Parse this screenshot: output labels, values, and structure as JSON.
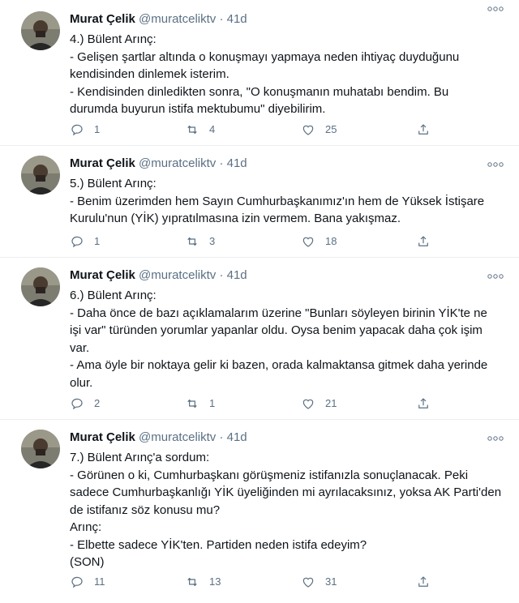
{
  "tweets": [
    {
      "name": "Murat Çelik",
      "handle": "@muratceliktv",
      "time": "41d",
      "lines": [
        "4.) Bülent Arınç:",
        "- Gelişen şartlar altında o konuşmayı yapmaya neden ihtiyaç duyduğunu",
        "kendisinden dinlemek isterim.",
        "- Kendisinden dinledikten sonra, \"O konuşmanın muhatabı bendim. Bu",
        "durumda buyurun istifa mektubumu\" diyebilirim."
      ],
      "replies": "1",
      "retweets": "4",
      "likes": "25"
    },
    {
      "name": "Murat Çelik",
      "handle": "@muratceliktv",
      "time": "41d",
      "lines": [
        "5.) Bülent Arınç:",
        "- Benim üzerimden hem Sayın Cumhurbaşkanımız'ın hem de Yüksek İstişare",
        "Kurulu'nun (YİK) yıpratılmasına izin vermem. Bana yakışmaz."
      ],
      "replies": "1",
      "retweets": "3",
      "likes": "18"
    },
    {
      "name": "Murat Çelik",
      "handle": "@muratceliktv",
      "time": "41d",
      "lines": [
        "6.) Bülent Arınç:",
        "- Daha önce de bazı açıklamalarım üzerine \"Bunları söyleyen birinin YİK'te ne",
        "işi var\" türünden yorumlar yapanlar oldu. Oysa benim yapacak daha çok işim",
        "var.",
        "- Ama öyle bir noktaya gelir ki bazen, orada kalmaktansa gitmek daha yerinde",
        "olur."
      ],
      "replies": "2",
      "retweets": "1",
      "likes": "21"
    },
    {
      "name": "Murat Çelik",
      "handle": "@muratceliktv",
      "time": "41d",
      "lines": [
        "7.) Bülent Arınç'a sordum:",
        "- Görünen o ki, Cumhurbaşkanı görüşmeniz istifanızla sonuçlanacak. Peki",
        "sadece Cumhurbaşkanlığı YİK üyeliğinden mi ayrılacaksınız, yoksa AK Parti'den",
        "de istifanız söz konusu mu?",
        "Arınç:",
        "- Elbette sadece YİK'ten. Partiden neden istifa edeyim?",
        "(SON)"
      ],
      "replies": "11",
      "retweets": "13",
      "likes": "31"
    }
  ],
  "icons": {
    "reply": "reply-icon",
    "retweet": "retweet-icon",
    "like": "heart-icon",
    "share": "share-icon",
    "more": "more-icon"
  },
  "colors": {
    "text": "#0f1419",
    "secondary": "#5b7083",
    "divider": "#ebeef0"
  }
}
